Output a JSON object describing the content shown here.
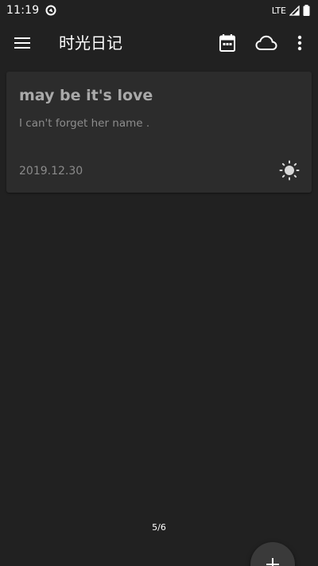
{
  "status_bar": {
    "time": "11:19",
    "network": "LTE"
  },
  "app_bar": {
    "title": "时光日记",
    "menu_icon": "menu-icon",
    "calendar_icon": "calendar-icon",
    "cloud_icon": "cloud-icon",
    "more_icon": "more-vert-icon"
  },
  "entries": [
    {
      "title": "may be it's love",
      "excerpt": "I can't forget her name .",
      "date": "2019.12.30",
      "weather_icon": "sun-icon"
    }
  ],
  "pagination": {
    "label": "5/6"
  },
  "fab": {
    "icon": "add-icon"
  },
  "colors": {
    "background": "#212121",
    "card": "#2c2c2c",
    "card_title": "#a9a9a9",
    "card_text": "#8d8d8d"
  }
}
